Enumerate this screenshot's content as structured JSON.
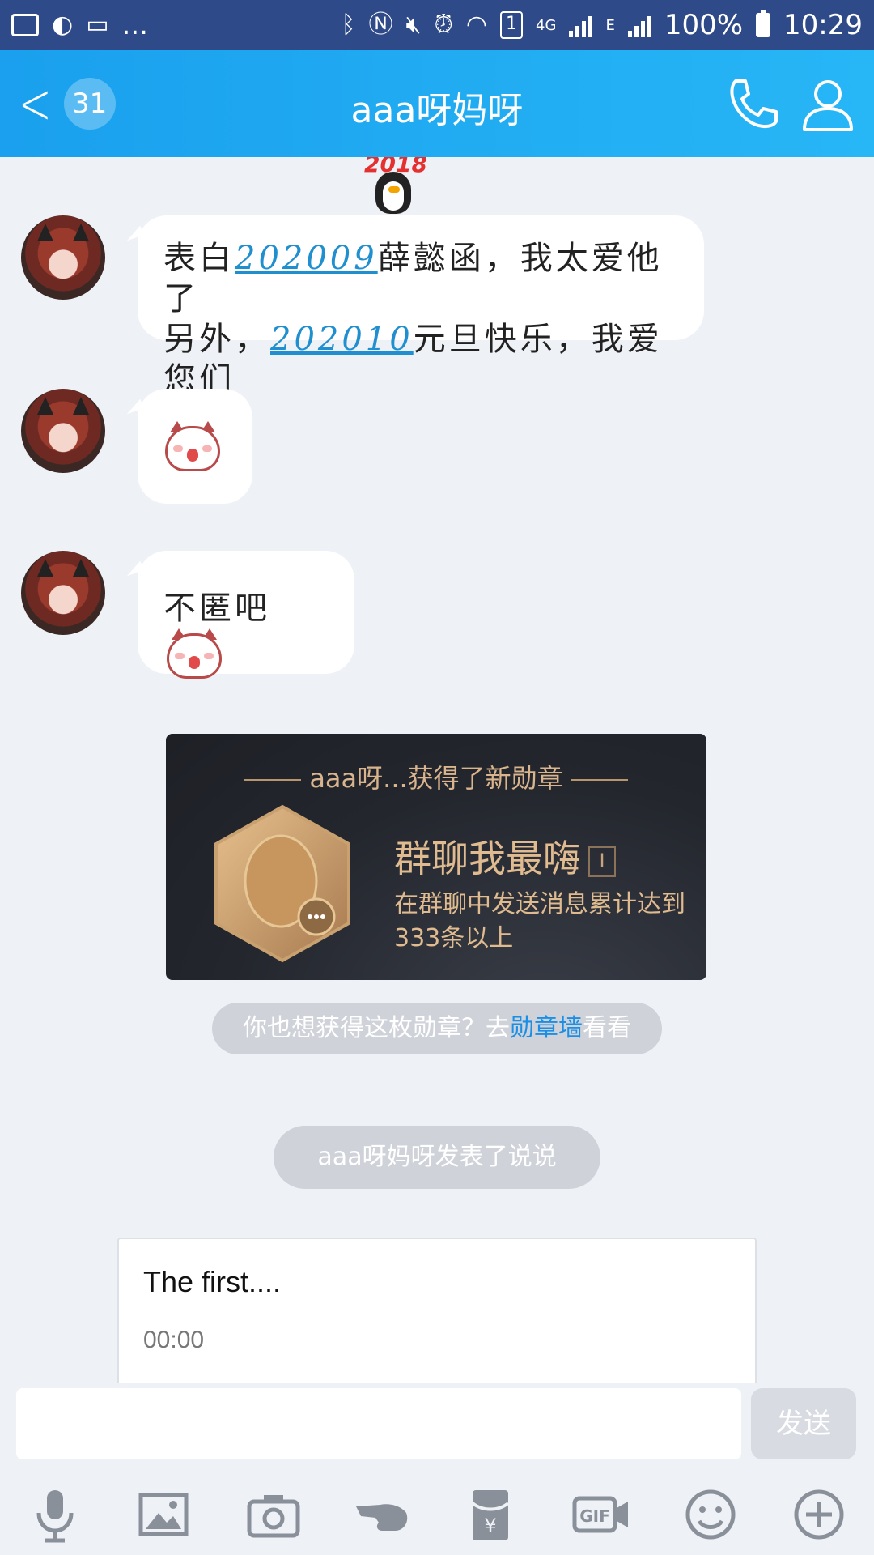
{
  "status_bar": {
    "network_type": "4G",
    "edge_label": "E",
    "sim_slot": "1",
    "battery": "100%",
    "time": "10:29",
    "overflow": "..."
  },
  "header": {
    "unread_count": "31",
    "title": "aaa呀妈呀",
    "icons": [
      "back-chevron-icon",
      "phone-icon",
      "profile-icon"
    ]
  },
  "messages": [
    {
      "type": "text",
      "parts": [
        {
          "text": "表白",
          "link": false
        },
        {
          "text": "202009",
          "link": true
        },
        {
          "text": "薛懿函，我太爱他了",
          "link": false
        },
        {
          "text": "另外，",
          "link": false
        },
        {
          "text": "202010",
          "link": true
        },
        {
          "text": "元旦快乐，我爱您们",
          "link": false
        }
      ]
    },
    {
      "type": "sticker",
      "sticker": "cat-covering-face-icon"
    },
    {
      "type": "text_sticker",
      "text": "不匿吧",
      "sticker": "cat-laughing-icon"
    }
  ],
  "medal": {
    "header": "aaa呀...获得了新勋章",
    "name": "群聊我最嗨",
    "level": "I",
    "desc": "在群聊中发送消息累计达到333条以上"
  },
  "medal_prompt": {
    "prefix": "你也想获得这枚勋章？去",
    "link": "勋章墙",
    "suffix": "看看"
  },
  "post_notice": "aaa呀妈呀发表了说说",
  "share_card": {
    "title": "The first....",
    "time": "00:00"
  },
  "composer": {
    "send_label": "发送",
    "tools": [
      "microphone-icon",
      "image-icon",
      "camera-icon",
      "poke-icon",
      "red-packet-icon",
      "gif-icon",
      "emoji-icon",
      "plus-icon"
    ]
  },
  "colors": {
    "header_start": "#1aa0ee",
    "header_end": "#27b6f6",
    "link": "#1f8fcf",
    "medal_gold": "#d8b48b",
    "status_bar": "#2f4a88"
  }
}
